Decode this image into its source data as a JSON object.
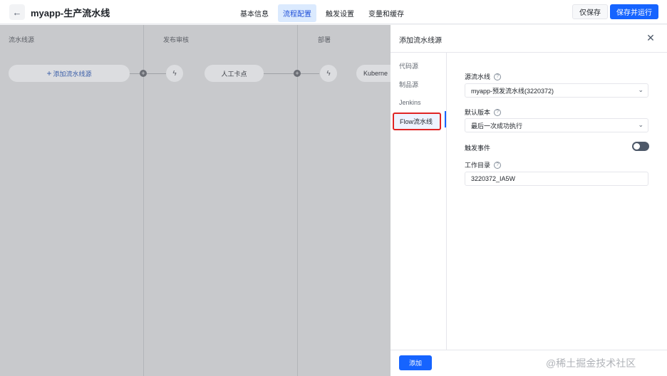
{
  "header": {
    "back_icon": "arrow-left-icon",
    "title": "myapp-生产流水线",
    "tabs": [
      {
        "label": "基本信息"
      },
      {
        "label": "流程配置"
      },
      {
        "label": "触发设置"
      },
      {
        "label": "变量和缓存"
      }
    ],
    "save_label": "仅保存",
    "save_run_label": "保存并运行",
    "accent_color": "#1664ff"
  },
  "canvas": {
    "stages": [
      {
        "label": "流水线源"
      },
      {
        "label": "发布审核"
      },
      {
        "label": "部署"
      }
    ],
    "add_source_label": "添加流水线源",
    "manual_card_label": "人工卡点",
    "deploy_card_label": "Kuberne"
  },
  "drawer": {
    "title": "添加流水线源",
    "nav": [
      {
        "label": "代码源"
      },
      {
        "label": "制品源"
      },
      {
        "label": "Jenkins"
      },
      {
        "label": "Flow流水线"
      }
    ],
    "fields": {
      "source_pipeline": {
        "label": "源流水线",
        "value": "myapp-预发流水线(3220372)"
      },
      "default_version": {
        "label": "默认版本",
        "value": "最后一次成功执行"
      },
      "trigger_event": {
        "label": "触发事件",
        "enabled": false
      },
      "work_dir": {
        "label": "工作目录",
        "value": "3220372_IA5W"
      }
    },
    "add_button_label": "添加"
  },
  "watermark": "@稀土掘金技术社区"
}
